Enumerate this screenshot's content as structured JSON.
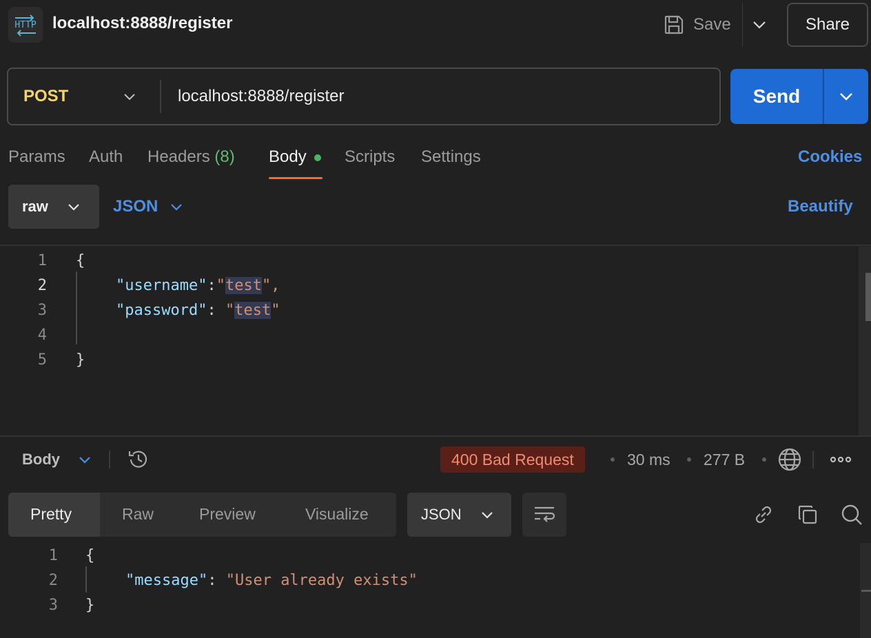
{
  "header": {
    "badge_text": "HTTP",
    "title": "localhost:8888/register",
    "save_label": "Save",
    "share_label": "Share"
  },
  "request": {
    "method": "POST",
    "url": "localhost:8888/register",
    "send_label": "Send"
  },
  "tabs": [
    {
      "label": "Params"
    },
    {
      "label": "Auth"
    },
    {
      "label": "Headers",
      "count": "(8)"
    },
    {
      "label": "Body",
      "active": true
    },
    {
      "label": "Scripts"
    },
    {
      "label": "Settings"
    }
  ],
  "cookies_label": "Cookies",
  "body_options": {
    "mode": "raw",
    "language": "JSON",
    "beautify_label": "Beautify"
  },
  "request_editor": {
    "line_numbers": [
      "1",
      "2",
      "3",
      "4",
      "5"
    ],
    "line1": "{",
    "line2_key": "\"username\"",
    "line2_colon": ":",
    "line2_q1": "\"",
    "line2_val": "test",
    "line2_q2": "\",",
    "line3_key": "\"password\"",
    "line3_colon": ": ",
    "line3_q1": "\"",
    "line3_val": "test",
    "line3_q2": "\"",
    "line5": "}"
  },
  "response": {
    "section_label": "Body",
    "status": "400 Bad Request",
    "time": "30 ms",
    "size": "277 B",
    "views": [
      "Pretty",
      "Raw",
      "Preview",
      "Visualize"
    ],
    "active_view": "Pretty",
    "format": "JSON",
    "line_numbers": [
      "1",
      "2",
      "3"
    ],
    "line1": "{",
    "line2_key": "\"message\"",
    "line2_colon": ": ",
    "line2_val": "\"User already exists\"",
    "line3": "}"
  },
  "colors": {
    "accent_blue": "#1f6bd6",
    "link_blue": "#4f8fe3",
    "method_yellow": "#f3d36b",
    "status_error_bg": "#5a2017",
    "status_error_text": "#f18a72",
    "active_tab_underline": "#f26b3a",
    "body_dot_green": "#4cb55f"
  },
  "icons": {
    "http_badge": "http-icon",
    "save": "floppy-disk-icon",
    "history": "history-icon",
    "network": "globe-icon",
    "more": "more-horizontal-icon",
    "wrap": "wrap-lines-icon",
    "link": "link-icon",
    "copy": "copy-icon",
    "search": "search-icon"
  }
}
